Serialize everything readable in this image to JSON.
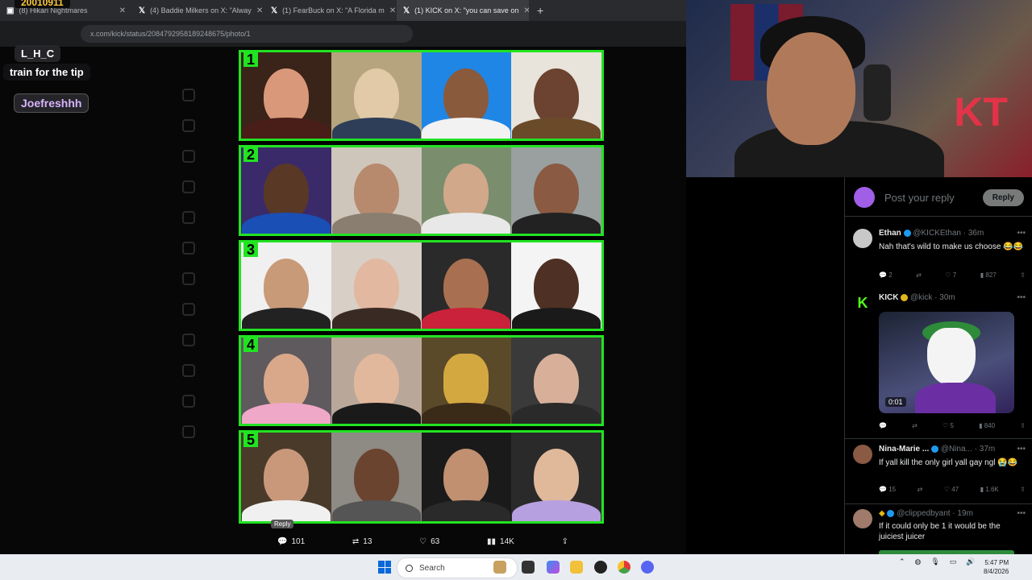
{
  "browser": {
    "tabs": [
      {
        "label": "(8) Hikari Nightmares"
      },
      {
        "label": "(4) Baddie Milkers on X: \"Alway"
      },
      {
        "label": "(1) FearBuck on X: \"A Florida m"
      },
      {
        "label": "(1) KICK on X: \"you can save on"
      }
    ],
    "address": "x.com/kick/status/2084792958189248675/photo/1"
  },
  "stream": {
    "badge": "20010911",
    "chat_username": "L_H_C",
    "chat_message": "train for the tip",
    "chat_username2": "Joefreshhh"
  },
  "grid": {
    "rows": [
      {
        "number": "1"
      },
      {
        "number": "2"
      },
      {
        "number": "3"
      },
      {
        "number": "4"
      },
      {
        "number": "5"
      }
    ]
  },
  "actions": {
    "reply_tooltip": "Reply",
    "replies": "101",
    "reposts": "13",
    "likes": "63",
    "views": "14K"
  },
  "compose": {
    "placeholder": "Post your reply",
    "button": "Reply"
  },
  "replies": [
    {
      "name": "Ethan",
      "handle": "@KICKEthan",
      "time": "· 36m",
      "text": "Nah that's wild to make us choose 😂😂",
      "stats": [
        "2",
        "",
        "7",
        "827",
        ""
      ]
    },
    {
      "name": "KICK",
      "handle": "@kick",
      "time": "· 30m",
      "video_time": "0:01",
      "stats": [
        "",
        "",
        "5",
        "840",
        ""
      ]
    },
    {
      "name": "Nina-Marie ...",
      "handle": "@Nina...",
      "time": "· 37m",
      "text": "If yall kill the only girl yall gay ngl 😭😂",
      "stats": [
        "15",
        "",
        "47",
        "1.6K",
        ""
      ]
    },
    {
      "name": "",
      "handle": "@clippedbyant",
      "time": "· 19m",
      "text": "If it could only be 1 it would be the juiciest juicer"
    }
  ],
  "taskbar": {
    "search_label": "Search",
    "time": "5:47 PM",
    "date": "8/4/2026"
  },
  "colors": {
    "grid_border": "#22e322",
    "x_blue": "#1d9bf0",
    "taskbar": "#e9edf2"
  }
}
